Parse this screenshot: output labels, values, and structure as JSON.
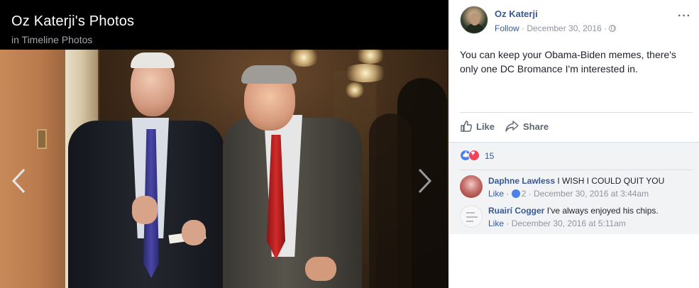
{
  "viewer": {
    "title": "Oz Katerji's Photos",
    "subtitle": "in Timeline Photos"
  },
  "post": {
    "author": "Oz Katerji",
    "follow_label": "Follow",
    "separator": " · ",
    "date": "December 30, 2016",
    "privacy_icon": "globe-icon",
    "more_label": "···",
    "text": "You can keep your Obama-Biden memes, there's only one DC Bromance I'm interested in."
  },
  "actions": {
    "like_label": "Like",
    "share_label": "Share"
  },
  "reactions": {
    "count": "15"
  },
  "comments": [
    {
      "author": "Daphne Lawless",
      "text": "I WISH I COULD QUIT YOU",
      "like_label": "Like",
      "sep": " · ",
      "likes": "2",
      "timestamp": "December 30, 2016 at 3:44am"
    },
    {
      "author": "Ruairí Cogger",
      "text": "I've always enjoyed his chips.",
      "like_label": "Like",
      "sep": " · ",
      "timestamp": "December 30, 2016 at 5:11am"
    }
  ],
  "colors": {
    "link": "#385898",
    "meta": "#90949c",
    "like_reaction": "#4a7ff0",
    "love_reaction": "#f0445a"
  }
}
